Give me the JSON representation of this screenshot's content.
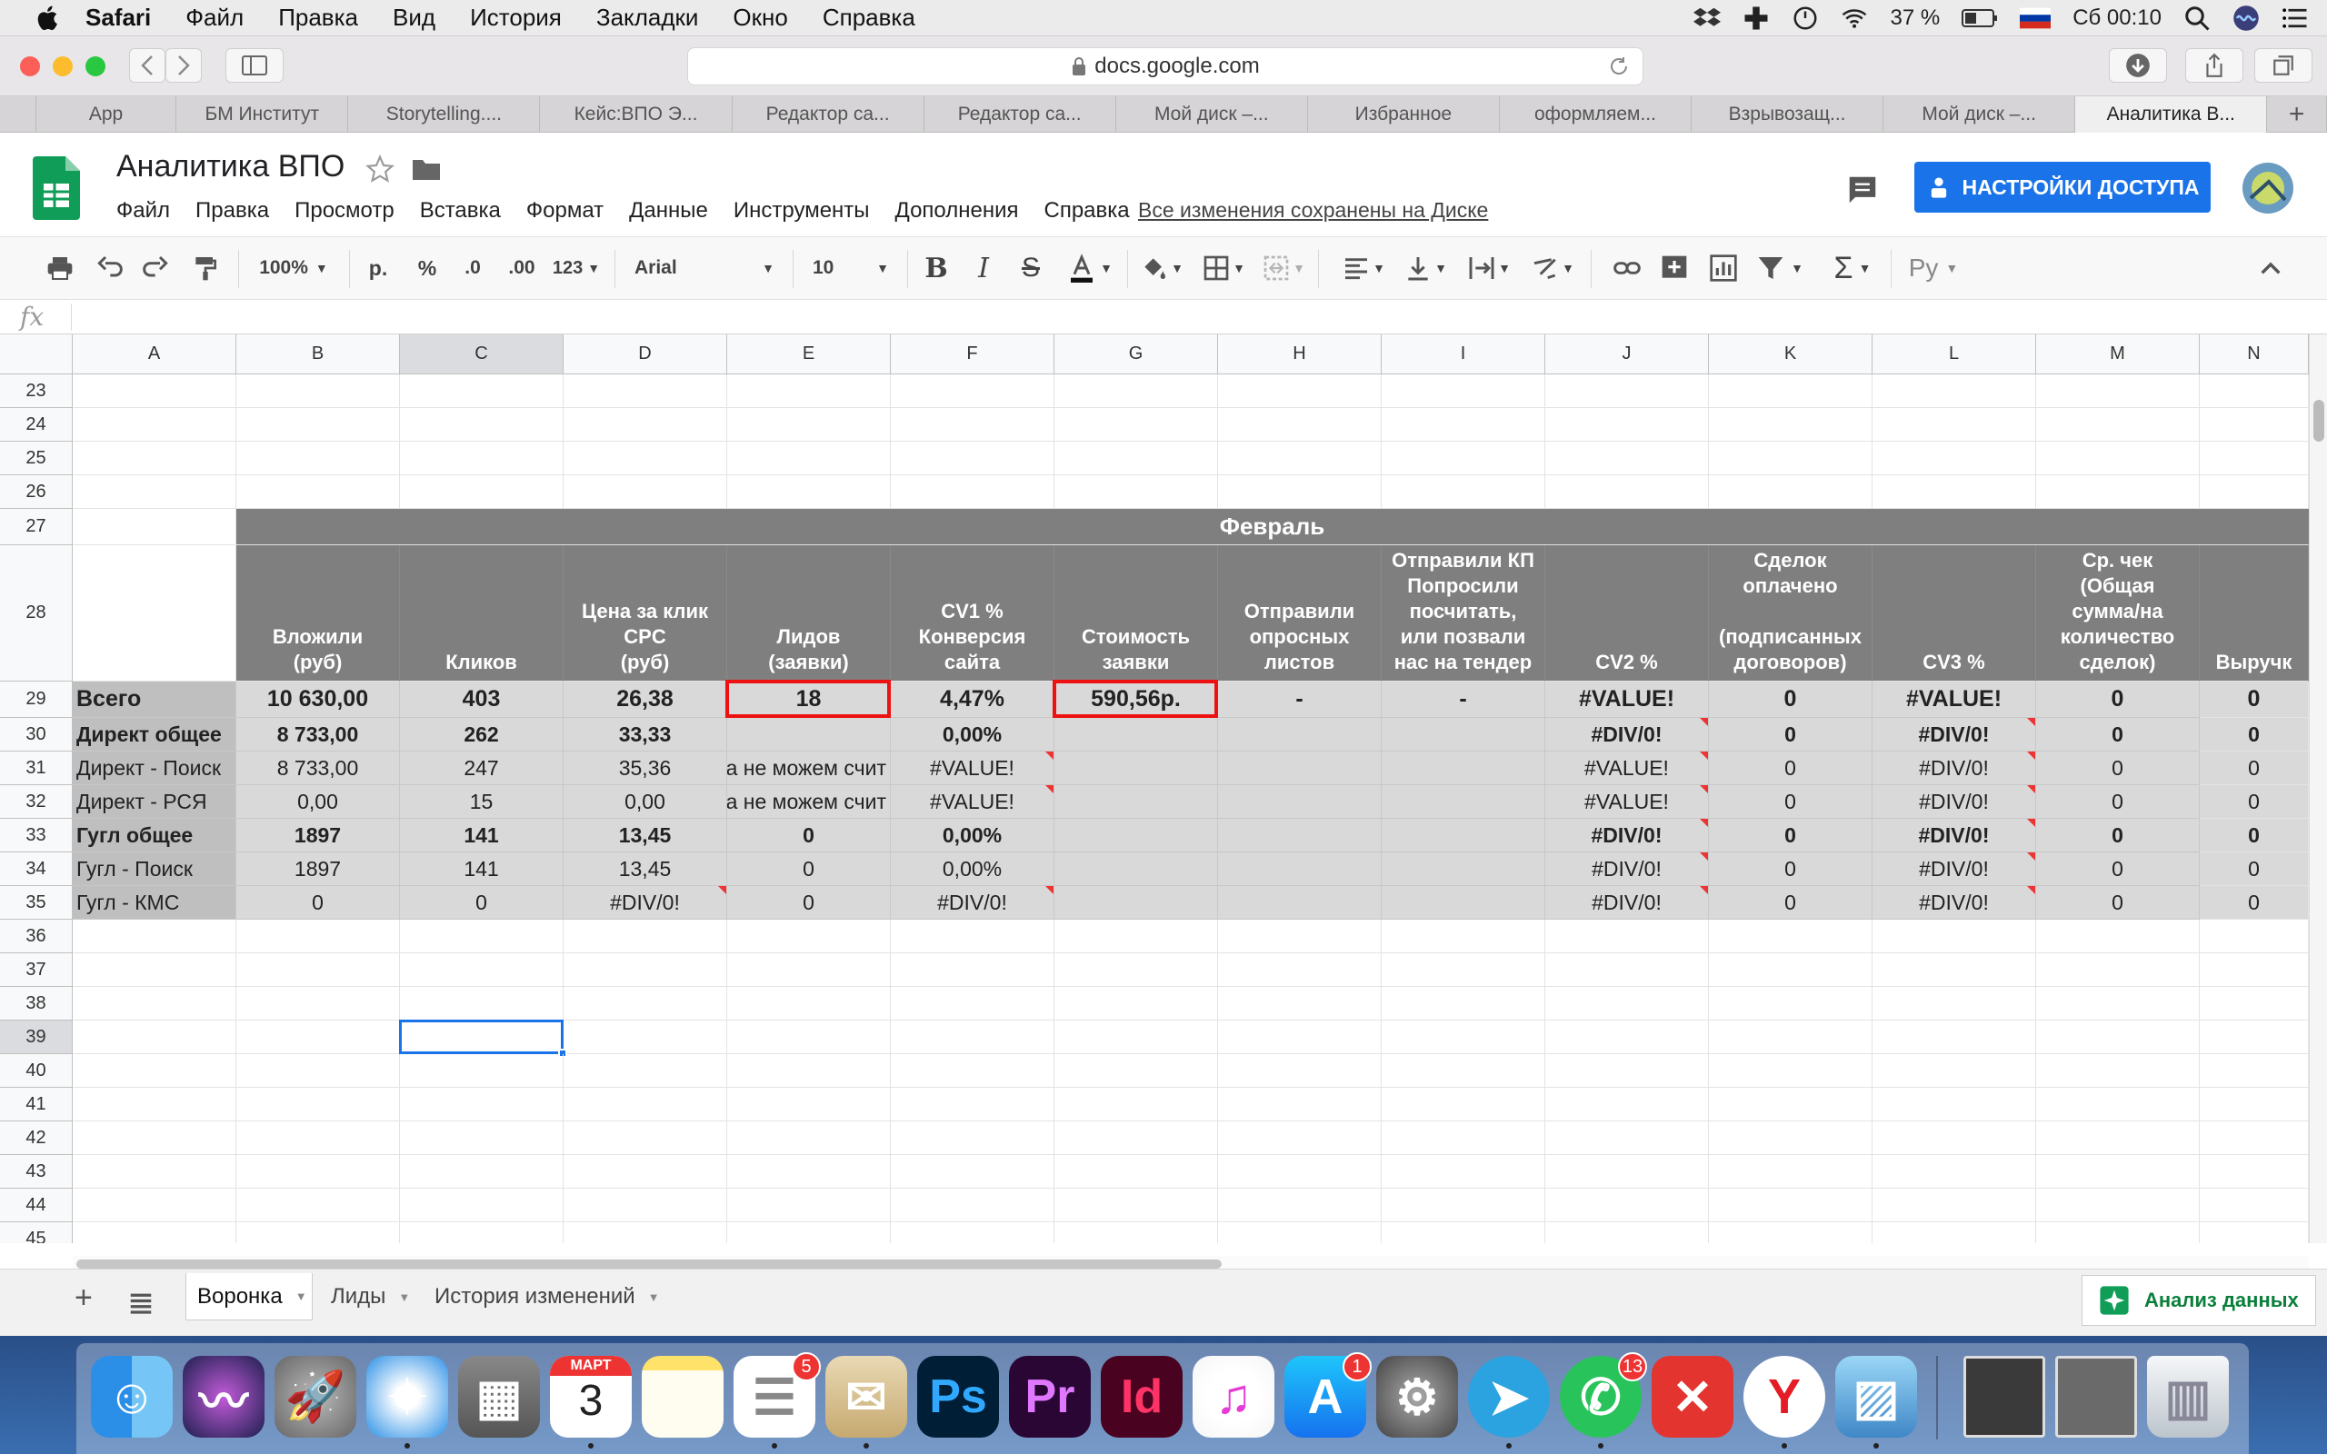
{
  "menubar": {
    "items": [
      "Safari",
      "Файл",
      "Правка",
      "Вид",
      "История",
      "Закладки",
      "Окно",
      "Справка"
    ],
    "battery": "37 %",
    "clock": "Сб 00:10"
  },
  "browser": {
    "url": "docs.google.com",
    "tabs": [
      "App",
      "БМ Институт",
      "Storytelling....",
      "Кейс:ВПО Э...",
      "Редактор са...",
      "Редактор са...",
      "Мой диск –...",
      "Избранное",
      "оформляем...",
      "Взрывозащ...",
      "Мой диск –...",
      "Аналитика В..."
    ],
    "active_tab": 11
  },
  "sheets": {
    "title": "Аналитика ВПО",
    "menus": [
      "Файл",
      "Правка",
      "Просмотр",
      "Вставка",
      "Формат",
      "Данные",
      "Инструменты",
      "Дополнения",
      "Справка"
    ],
    "saved": "Все изменения сохранены на Диске",
    "share": "НАСТРОЙКИ ДОСТУПА",
    "colors": {
      "accent": "#1a73e8",
      "header": "#7f7f7f",
      "row": "#d9d9d9",
      "highlight": "#e11111"
    }
  },
  "toolbar": {
    "zoom": "100%",
    "currency": "р.",
    "percent": "%",
    "dec_less": ".0",
    "dec_more": ".00",
    "format_more": "123",
    "font": "Arial",
    "size": "10",
    "input_tool": "Ру"
  },
  "formula": {
    "fx": "fx"
  },
  "columns": [
    "A",
    "B",
    "C",
    "D",
    "E",
    "F",
    "G",
    "H",
    "I",
    "J",
    "K",
    "L",
    "M",
    "N"
  ],
  "rows_top": [
    "23",
    "24",
    "25",
    "26",
    "27",
    "28"
  ],
  "section_title": "Февраль",
  "headers": {
    "B": "Вложили\n(руб)",
    "C": "Кликов",
    "D": "Цена за клик\nCPC\n(руб)",
    "E": "Лидов\n(заявки)",
    "F": "CV1 %\nКонверсия\nсайта",
    "G": "Стоимость\nзаявки",
    "H": "Отправили\nопросных\nлистов",
    "I": "Отправили КП\nПопросили\nпосчитать,\nили позвали\nнас на тендер",
    "J": "CV2 %",
    "K": "Сделок\nоплачено\n\n(подписанных\nдоговоров)",
    "L": "CV3 %",
    "M": "Ср. чек\n(Общая\nсумма/на\nколичество\nсделок)",
    "N": "Выручк"
  },
  "data_rows": [
    {
      "num": "29",
      "bold": true,
      "cells": [
        "Всего",
        "10 630,00",
        "403",
        "26,38",
        "18",
        "4,47%",
        "590,56р.",
        "-",
        "-",
        "#VALUE!",
        "0",
        "#VALUE!",
        "0",
        "0"
      ]
    },
    {
      "num": "30",
      "bold": true,
      "cells": [
        "Директ общее",
        "8 733,00",
        "262",
        "33,33",
        "",
        "0,00%",
        "",
        "",
        "",
        "#DIV/0!",
        "0",
        "#DIV/0!",
        "0",
        "0"
      ]
    },
    {
      "num": "31",
      "bold": false,
      "cells": [
        "Директ - Поиск",
        "8 733,00",
        "247",
        "35,36",
        "ка не можем счит",
        "#VALUE!",
        "",
        "",
        "",
        "#VALUE!",
        "0",
        "#DIV/0!",
        "0",
        "0"
      ]
    },
    {
      "num": "32",
      "bold": false,
      "cells": [
        "Директ - РСЯ",
        "0,00",
        "15",
        "0,00",
        "ка не можем счит",
        "#VALUE!",
        "",
        "",
        "",
        "#VALUE!",
        "0",
        "#DIV/0!",
        "0",
        "0"
      ]
    },
    {
      "num": "33",
      "bold": true,
      "cells": [
        "Гугл общее",
        "1897",
        "141",
        "13,45",
        "0",
        "0,00%",
        "",
        "",
        "",
        "#DIV/0!",
        "0",
        "#DIV/0!",
        "0",
        "0"
      ]
    },
    {
      "num": "34",
      "bold": false,
      "cells": [
        "Гугл - Поиск",
        "1897",
        "141",
        "13,45",
        "0",
        "0,00%",
        "",
        "",
        "",
        "#DIV/0!",
        "0",
        "#DIV/0!",
        "0",
        "0"
      ]
    },
    {
      "num": "35",
      "bold": false,
      "cells": [
        "Гугл - КМС",
        "0",
        "0",
        "#DIV/0!",
        "0",
        "#DIV/0!",
        "",
        "",
        "",
        "#DIV/0!",
        "0",
        "#DIV/0!",
        "0",
        "0"
      ]
    }
  ],
  "rows_bottom": [
    "36",
    "37",
    "38",
    "39",
    "40",
    "41",
    "42",
    "43",
    "44",
    "45"
  ],
  "sheet_tabs": [
    "Воронка",
    "Лиды",
    "История изменений"
  ],
  "explore": "Анализ данных",
  "dock": {
    "calendar_month": "МАРТ",
    "calendar_day": "3",
    "reminders_badge": "5",
    "appstore_badge": "1",
    "whatsapp_badge": "13",
    "ps": "Ps",
    "pr": "Pr",
    "id": "Id"
  }
}
